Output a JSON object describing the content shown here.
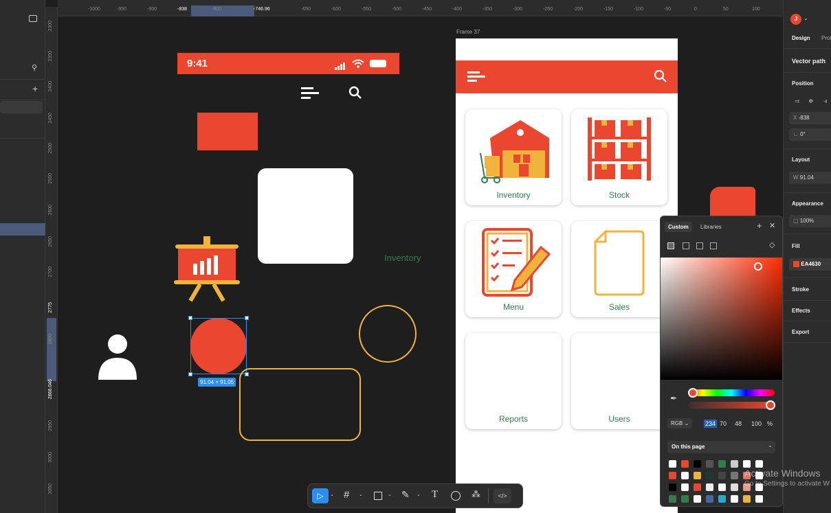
{
  "ruler": {
    "x_ticks": [
      "-1000",
      "-950",
      "-900",
      "-838",
      "-800",
      "-746.96",
      "-650",
      "-600",
      "-550",
      "-500",
      "-450",
      "-400",
      "-350",
      "-300",
      "-250",
      "-200",
      "-150",
      "-100",
      "-50",
      "0",
      "50",
      "100"
    ],
    "y_ticks": [
      "2300",
      "2350",
      "2400",
      "2450",
      "2500",
      "2550",
      "2600",
      "2650",
      "2700",
      "2775",
      "2800",
      "2866.046",
      "2950",
      "3000",
      "3050"
    ]
  },
  "left_frame": {
    "status_time": "9:41",
    "inventory_text": "Inventory",
    "selection_size": "91.04 × 91.05"
  },
  "frame37": {
    "label": "Frame 37",
    "cards": [
      {
        "label": "Inventory"
      },
      {
        "label": "Stock"
      },
      {
        "label": "Menu"
      },
      {
        "label": "Sales"
      },
      {
        "label": "Reports"
      },
      {
        "label": "Users"
      }
    ]
  },
  "color_picker": {
    "tab_custom": "Custom",
    "tab_libraries": "Libraries",
    "mode": "RGB",
    "r": "234",
    "g": "70",
    "b": "48",
    "alpha": "100",
    "percent": "%",
    "page_select": "On this page",
    "swatches": [
      "#ffffff",
      "#ea4630",
      "#000000",
      "#555555",
      "#2e7d4a",
      "#cccccc",
      "#ffffff",
      "#ffffff",
      "#ea4630",
      "#ffffff",
      "#f0b43c",
      "#1e3a34",
      "#444444",
      "#777777",
      "#ea7060",
      "#ffffff",
      "#000000",
      "#ffffff",
      "#ea4630",
      "#eeeeee",
      "#ffffff",
      "#dddddd",
      "#ee9988",
      "#ffffff",
      "#3a7a4a",
      "#2e7d4a",
      "#ffffff",
      "#4466aa",
      "#22aacc",
      "#ffffff",
      "#f0b43c",
      "#ffffff"
    ]
  },
  "right_panel": {
    "avatar_letter": "J",
    "tab_design": "Design",
    "tab_proto": "Prot",
    "section_title": "Vector path",
    "position": "Position",
    "x_label": "X",
    "x_value": "-838",
    "rotation": "0°",
    "layout": "Layout",
    "w_label": "W",
    "w_value": "91.04",
    "appearance": "Appearance",
    "opacity": "100%",
    "fill": "Fill",
    "fill_hex": "EA4630",
    "stroke": "Stroke",
    "effects": "Effects",
    "export": "Export"
  },
  "watermark": {
    "line1": "Activate Windows",
    "line2": "Go to Settings to activate W"
  },
  "colors": {
    "accent": "#ea4630",
    "gold": "#f0b43c",
    "green": "#2e7d4a",
    "select_blue": "#2b8ef0"
  }
}
